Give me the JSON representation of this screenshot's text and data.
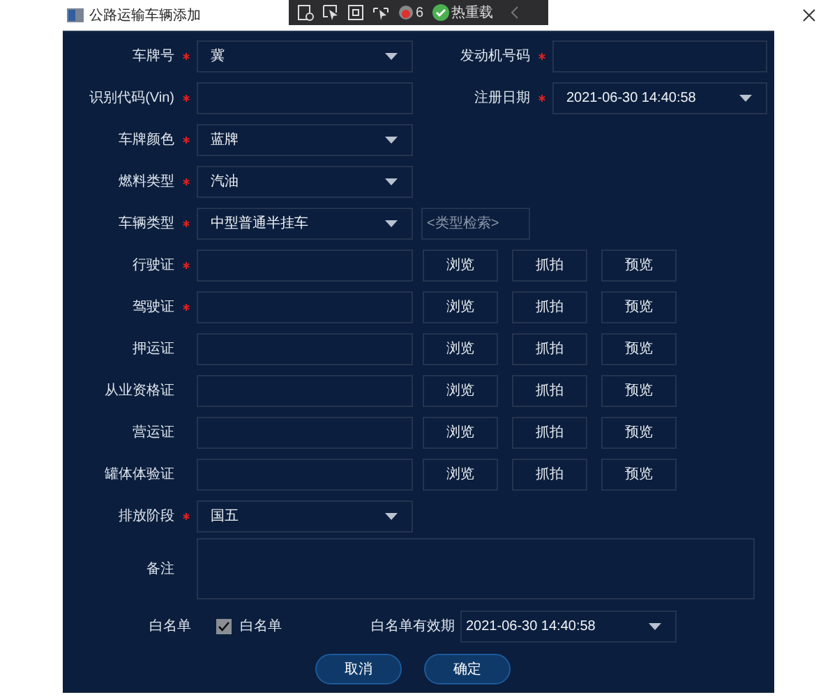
{
  "window": {
    "title": "公路运输车辆添加"
  },
  "debug_toolbar": {
    "count": "6",
    "hot_reload": "热重载"
  },
  "rows": [
    {
      "fields": [
        {
          "kind": "select",
          "label": "车牌号",
          "required": true,
          "value": "冀"
        },
        {
          "kind": "input",
          "label": "发动机号码",
          "required": true
        }
      ]
    },
    {
      "fields": [
        {
          "kind": "input",
          "label": "识别代码(Vin)",
          "required": true
        },
        {
          "kind": "select",
          "label": "注册日期",
          "required": true,
          "value": "2021-06-30 14:40:58"
        }
      ]
    },
    {
      "fields": [
        {
          "kind": "select",
          "label": "车牌颜色",
          "required": true,
          "value": "蓝牌"
        }
      ]
    },
    {
      "fields": [
        {
          "kind": "select",
          "label": "燃料类型",
          "required": true,
          "value": "汽油"
        }
      ]
    },
    {
      "fields": [
        {
          "kind": "select",
          "label": "车辆类型",
          "required": true,
          "value": "中型普通半挂车"
        },
        {
          "kind": "search",
          "placeholder": "<类型检索>"
        }
      ]
    },
    {
      "fields": [
        {
          "kind": "file",
          "label": "行驶证",
          "required": true,
          "buttons": [
            "浏览",
            "抓拍",
            "预览"
          ]
        }
      ]
    },
    {
      "fields": [
        {
          "kind": "file",
          "label": "驾驶证",
          "required": true,
          "buttons": [
            "浏览",
            "抓拍",
            "预览"
          ]
        }
      ]
    },
    {
      "fields": [
        {
          "kind": "file",
          "label": "押运证",
          "required": false,
          "buttons": [
            "浏览",
            "抓拍",
            "预览"
          ]
        }
      ]
    },
    {
      "fields": [
        {
          "kind": "file",
          "label": "从业资格证",
          "required": false,
          "buttons": [
            "浏览",
            "抓拍",
            "预览"
          ]
        }
      ]
    },
    {
      "fields": [
        {
          "kind": "file",
          "label": "营运证",
          "required": false,
          "buttons": [
            "浏览",
            "抓拍",
            "预览"
          ]
        }
      ]
    },
    {
      "fields": [
        {
          "kind": "file",
          "label": "罐体体验证",
          "required": false,
          "buttons": [
            "浏览",
            "抓拍",
            "预览"
          ]
        }
      ]
    },
    {
      "fields": [
        {
          "kind": "select",
          "label": "排放阶段",
          "required": true,
          "value": "国五"
        }
      ]
    }
  ],
  "remark": {
    "label": "备注"
  },
  "whitelist": {
    "label": "白名单",
    "checkbox": {
      "label": "白名单",
      "checked": true
    },
    "expiry": {
      "label": "白名单有效期",
      "value": "2021-06-30 14:40:58"
    }
  },
  "actions": [
    "取消",
    "确定"
  ]
}
